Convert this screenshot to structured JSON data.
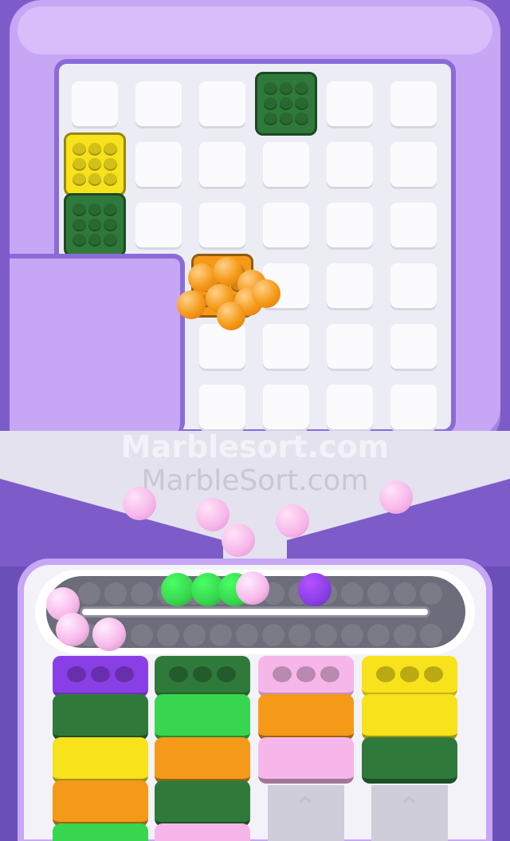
{
  "watermark": {
    "line1": "Marblesort.com",
    "line2": "MarbleSort.com"
  },
  "colors": {
    "frame": "#c7a6f5",
    "frame_dark": "#7d5cc9",
    "board": "#ecedf4",
    "green": "#2f7a3a",
    "yellow": "#f7e21b",
    "orange": "#f59a18",
    "pink": "#f7b6ea",
    "bright_green": "#38d64e",
    "purple": "#8a3fe6"
  },
  "board": {
    "rows": 6,
    "cols": 6,
    "blocks": [
      {
        "color": "green",
        "row": 0,
        "col": 3
      },
      {
        "color": "yellow",
        "row": 1,
        "col": 0
      },
      {
        "color": "green",
        "row": 2,
        "col": 0
      },
      {
        "color": "orange",
        "row": 3,
        "col": 2
      }
    ]
  },
  "conveyor": {
    "marbles": [
      "pink",
      "pink",
      "pink",
      "bright_green",
      "bright_green",
      "bright_green",
      "pink",
      "purple"
    ]
  },
  "trays": {
    "columns": [
      {
        "head": "purple",
        "stack": [
          "green",
          "yellow",
          "orange",
          "bright_green"
        ]
      },
      {
        "head": "green",
        "stack": [
          "bright_green",
          "orange",
          "green",
          "pink"
        ]
      },
      {
        "head": "pink",
        "stack": [
          "orange",
          "pink"
        ]
      },
      {
        "head": "yellow",
        "stack": [
          "yellow",
          "green"
        ]
      }
    ]
  }
}
